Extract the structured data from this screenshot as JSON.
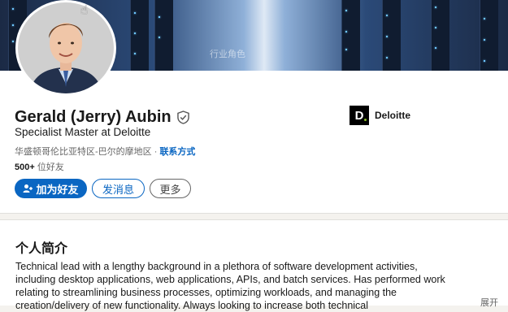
{
  "banner": {
    "watermark": "行业角色"
  },
  "profile": {
    "name": "Gerald (Jerry) Aubin",
    "headline": "Specialist Master at Deloitte",
    "location": "华盛顿哥伦比亚特区-巴尔的摩地区 · ",
    "contact_link": "联系方式",
    "friends_count": "500+",
    "friends_label": " 位好友"
  },
  "company": {
    "logo_letter": "D",
    "name": "Deloitte"
  },
  "actions": {
    "connect": "加为好友",
    "message": "发消息",
    "more": "更多"
  },
  "about": {
    "title": "个人简介",
    "text": "Technical lead with a lengthy background in a plethora of software development activities, including desktop applications, web applications, APIs, and batch services. Has performed work relating to streamlining business processes, optimizing workloads, and managing the creation/delivery of new functionality. Always looking to increase both technical",
    "expand": "展开"
  },
  "colors": {
    "accent": "#0a66c2",
    "deloitte_green": "#86bc25"
  }
}
